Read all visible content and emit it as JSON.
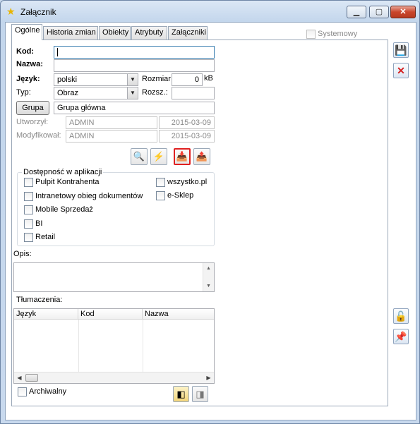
{
  "window": {
    "title": "Załącznik",
    "minimize": "▁",
    "maximize": "▢",
    "close": "✕"
  },
  "tabs": [
    {
      "label": "Ogólne"
    },
    {
      "label": "Historia zmian"
    },
    {
      "label": "Obiekty"
    },
    {
      "label": "Atrybuty"
    },
    {
      "label": "Załączniki"
    }
  ],
  "systemowy": {
    "label": "Systemowy",
    "checked": false
  },
  "form": {
    "kod_label": "Kod:",
    "kod_value": "",
    "nazwa_label": "Nazwa:",
    "nazwa_value": "",
    "jezyk_label": "Język:",
    "jezyk_value": "polski",
    "rozmiar_label": "Rozmiar:",
    "rozmiar_value": "0",
    "rozmiar_unit": "kB",
    "typ_label": "Typ:",
    "typ_value": "Obraz",
    "rozsz_label": "Rozsz.:",
    "rozsz_value": "",
    "grupa_button": "Grupa",
    "grupa_value": "Grupa główna",
    "utworzyl_label": "Utworzył:",
    "utworzyl_user": "ADMIN",
    "utworzyl_date": "2015-03-09",
    "modyfikowal_label": "Modyfikował:",
    "modyfikowal_user": "ADMIN",
    "modyfikowal_date": "2015-03-09"
  },
  "toolbar_icons": [
    {
      "name": "preview-icon",
      "glyph": "🔍"
    },
    {
      "name": "scan-icon",
      "glyph": "⚡"
    },
    {
      "name": "load-from-file-icon",
      "glyph": "📥"
    },
    {
      "name": "save-to-file-icon",
      "glyph": "📤"
    }
  ],
  "availability": {
    "title": "Dostępność w aplikacji",
    "left": [
      {
        "label": "Pulpit Kontrahenta",
        "checked": false
      },
      {
        "label": "Intranetowy obieg dokumentów",
        "checked": false
      },
      {
        "label": "Mobile Sprzedaż",
        "checked": false
      },
      {
        "label": "BI",
        "checked": false
      },
      {
        "label": "Retail",
        "checked": false
      }
    ],
    "right": [
      {
        "label": "wszystko.pl",
        "checked": false
      },
      {
        "label": "e-Sklep",
        "checked": false
      }
    ]
  },
  "opis": {
    "label": "Opis:",
    "value": ""
  },
  "translations": {
    "label": "Tłumaczenia:",
    "columns": [
      "Język",
      "Kod",
      "Nazwa"
    ],
    "rows": []
  },
  "archiwalny": {
    "label": "Archiwalny",
    "checked": false
  },
  "side_buttons": {
    "save": "💾",
    "cancel": "✕",
    "unlock": "🔓",
    "pin": "📌"
  },
  "bottom_icons": [
    {
      "name": "add-translation-icon",
      "glyph": "◧"
    },
    {
      "name": "remove-translation-icon",
      "glyph": "◨"
    }
  ]
}
